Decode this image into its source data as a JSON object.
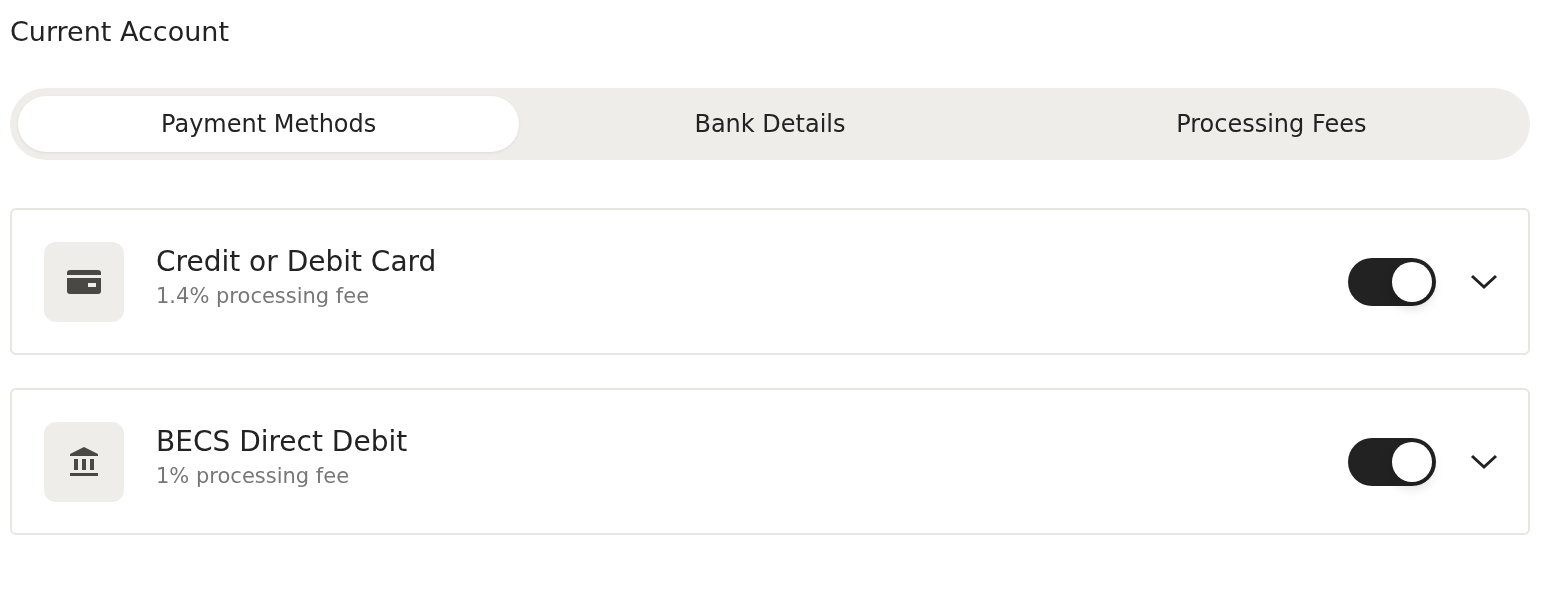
{
  "title": "Current Account",
  "tabs": [
    {
      "label": "Payment Methods",
      "selected": true
    },
    {
      "label": "Bank Details",
      "selected": false
    },
    {
      "label": "Processing Fees",
      "selected": false
    }
  ],
  "payment_methods": [
    {
      "kind": "card",
      "name": "Credit or Debit Card",
      "fee": "1.4% processing fee",
      "on": true,
      "expanded": false
    },
    {
      "kind": "bank",
      "name": "BECS Direct Debit",
      "fee": "1% processing fee",
      "on": true,
      "expanded": false
    }
  ]
}
